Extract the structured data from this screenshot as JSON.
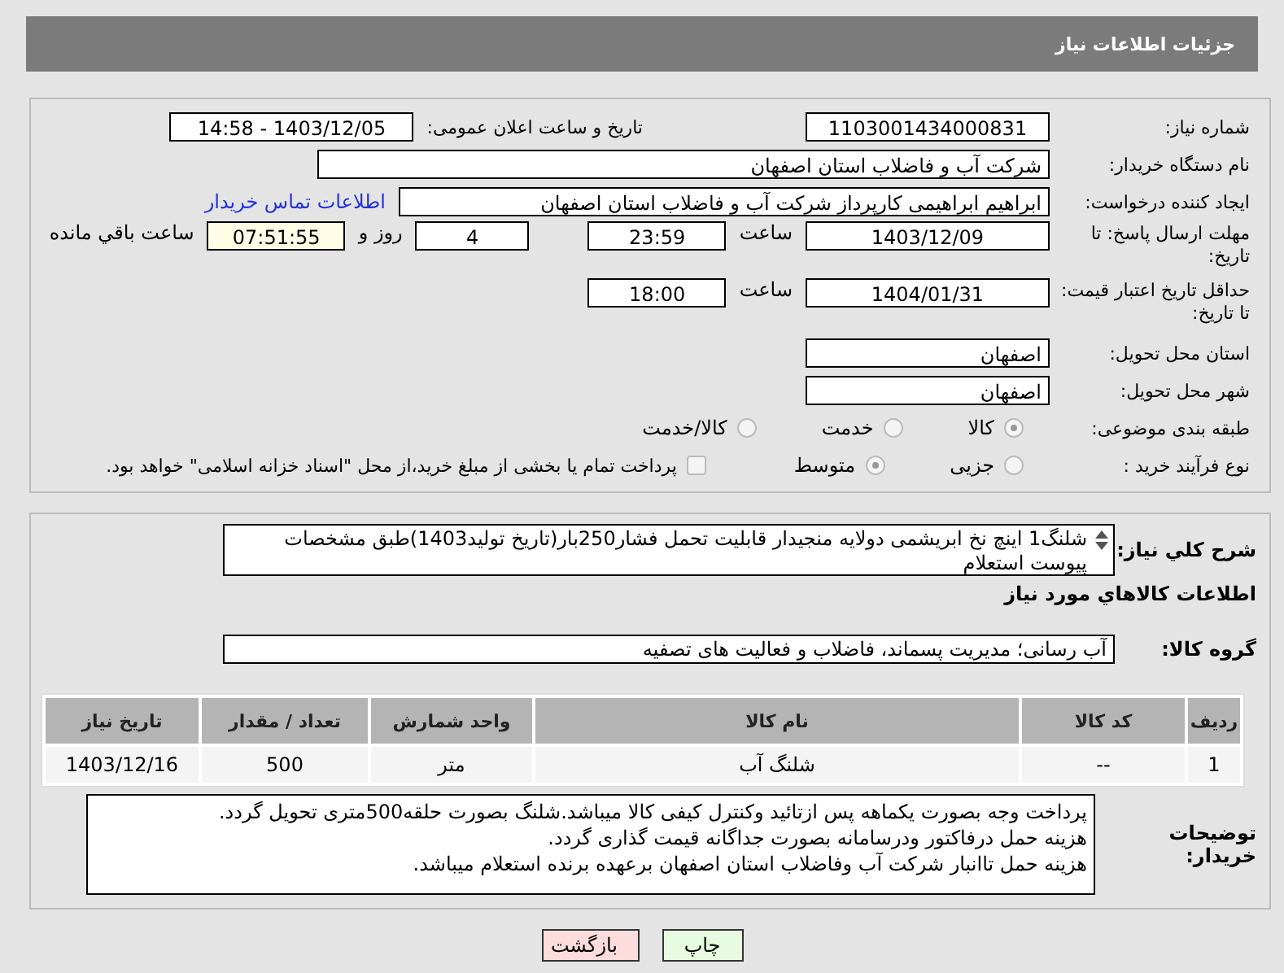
{
  "header": {
    "title": "جزئیات اطلاعات نیاز"
  },
  "need_number": {
    "label": "شماره نیاز:",
    "value": "1103001434000831"
  },
  "announce": {
    "label": "تاریخ و ساعت اعلان عمومی:",
    "value": "1403/12/05 - 14:58"
  },
  "buyer_org": {
    "label": "نام دستگاه خریدار:",
    "value": "شرکت آب و فاضلاب استان اصفهان"
  },
  "requester": {
    "label": "ایجاد کننده درخواست:",
    "value": "ابراهیم ابراهیمی کارپرداز شرکت آب و فاضلاب استان اصفهان",
    "link": "اطلاعات تماس خریدار"
  },
  "deadline": {
    "label": "مهلت ارسال پاسخ: تا تاریخ:",
    "date": "1403/12/09",
    "time_label": "ساعت",
    "time": "23:59",
    "days": "4",
    "days_label": "روز و",
    "remaining": "07:51:55",
    "remaining_label": "ساعت باقي مانده"
  },
  "validity": {
    "label": "حداقل تاریخ اعتبار قیمت: تا تاریخ:",
    "date": "1404/01/31",
    "time_label": "ساعت",
    "time": "18:00"
  },
  "province": {
    "label": "استان محل تحویل:",
    "value": "اصفهان"
  },
  "city": {
    "label": "شهر محل تحویل:",
    "value": "اصفهان"
  },
  "category": {
    "label": "طبقه بندی موضوعی:",
    "options": [
      {
        "label": "کالا",
        "selected": true
      },
      {
        "label": "خدمت",
        "selected": false
      },
      {
        "label": "کالا/خدمت",
        "selected": false
      }
    ]
  },
  "process": {
    "label": "نوع فرآیند خرید :",
    "options": [
      {
        "label": "جزیی",
        "selected": false
      },
      {
        "label": "متوسط",
        "selected": true
      }
    ],
    "payment": {
      "checked": false,
      "label": "پرداخت تمام یا بخشی از مبلغ خرید،از محل \"اسناد خزانه اسلامی\" خواهد بود."
    }
  },
  "description": {
    "label": "شرح کلي نياز:",
    "value": "شلنگ1 اینچ نخ ابریشمی دولایه منجیدار قابلیت تحمل فشار250بار(تاریخ تولید1403)طبق مشخصات پیوست استعلام"
  },
  "goods_title": "اطلاعات کالاهاي مورد نياز",
  "goods_group": {
    "label": "گروه کالا:",
    "value": "آب رسانی؛ مدیریت پسماند، فاضلاب و فعالیت های تصفیه"
  },
  "table": {
    "columns": [
      "ردیف",
      "کد کالا",
      "نام کالا",
      "واحد شمارش",
      "تعداد / مقدار",
      "تاریخ نیاز"
    ],
    "rows": [
      [
        "1",
        "--",
        "شلنگ آب",
        "متر",
        "500",
        "1403/12/16"
      ]
    ]
  },
  "buyer_notes": {
    "label": "توضیحات خریدار:",
    "lines": [
      "پرداخت وجه بصورت یکماهه پس ازتائید وکنترل کیفی کالا میباشد.شلنگ بصورت حلقه500متری تحویل گردد.",
      "هزینه حمل درفاکتور ودرسامانه بصورت جداگانه قیمت گذاری گردد.",
      "هزینه حمل تاانبار شرکت آب وفاضلاب استان اصفهان برعهده برنده استعلام میباشد."
    ]
  },
  "buttons": [
    {
      "label": "چاپ",
      "kind": "print"
    },
    {
      "label": "بازگشت",
      "kind": "back"
    }
  ]
}
